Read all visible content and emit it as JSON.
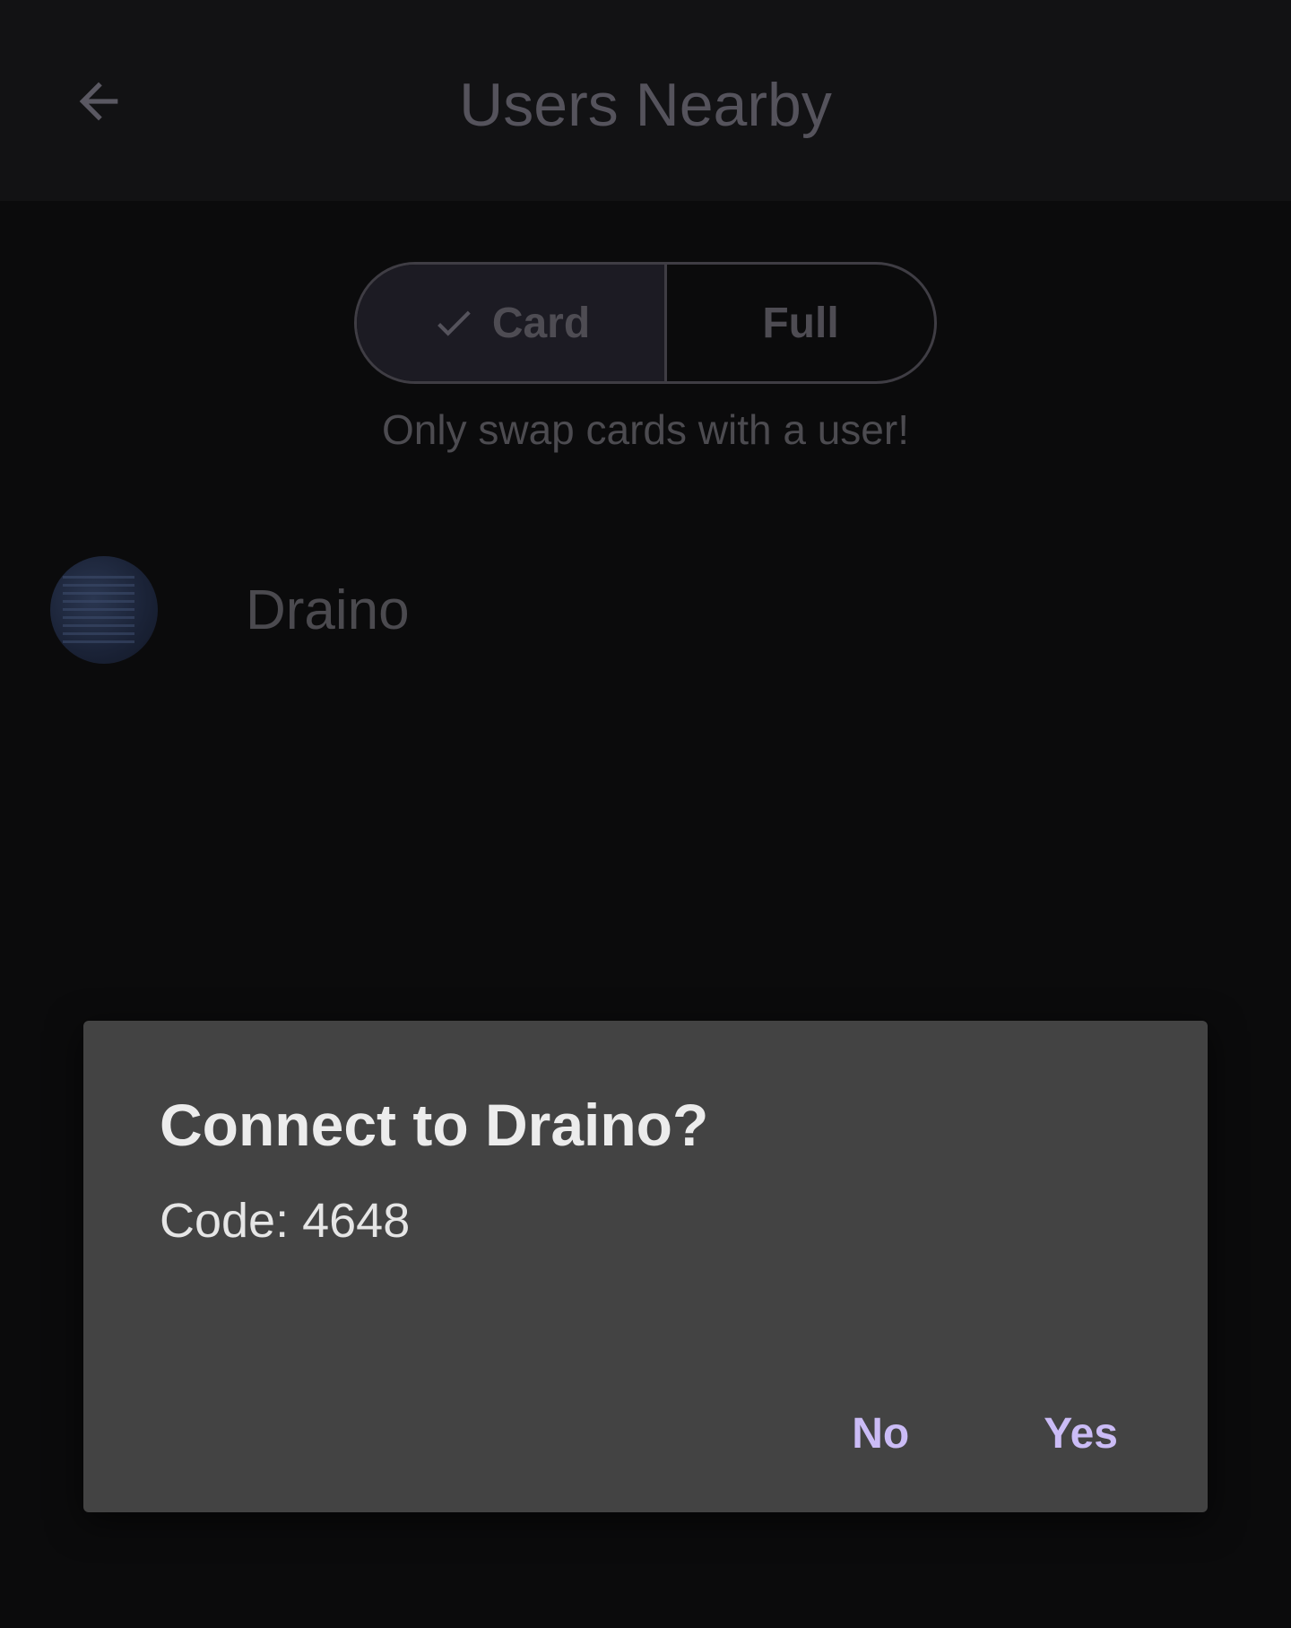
{
  "app_bar": {
    "title": "Users Nearby",
    "back_icon": "arrow-left-icon"
  },
  "mode_toggle": {
    "options": [
      {
        "label": "Card",
        "selected": true
      },
      {
        "label": "Full",
        "selected": false
      }
    ],
    "check_icon": "check-icon"
  },
  "hint": "Only swap cards with a user!",
  "users": [
    {
      "name": "Draino"
    }
  ],
  "dialog": {
    "title": "Connect to Draino?",
    "body": "Code: 4648",
    "actions": {
      "no": "No",
      "yes": "Yes"
    }
  },
  "colors": {
    "accent": "#cbbcf6",
    "dialog_bg": "#434343",
    "background": "#0b0b0c"
  }
}
